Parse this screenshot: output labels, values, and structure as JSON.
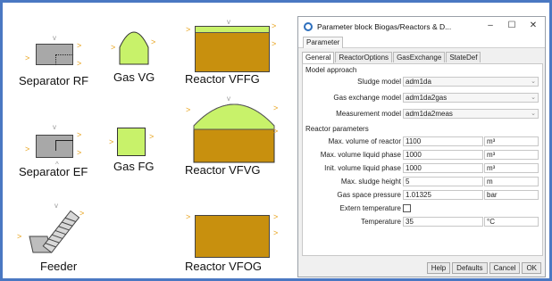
{
  "blocks": {
    "separator_rf": "Separator RF",
    "gas_vg": "Gas VG",
    "reactor_vffg": "Reactor VFFG",
    "separator_ef": "Separator EF",
    "gas_fg": "Gas FG",
    "reactor_vfvg": "Reactor VFVG",
    "feeder": "Feeder",
    "reactor_vfog": "Reactor VFOG"
  },
  "dialog": {
    "title": "Parameter block Biogas/Reactors & D...",
    "menu_label": "Parameter",
    "tabs": [
      "General",
      "ReactorOptions",
      "GasExchange",
      "StateDef"
    ],
    "section_model": "Model approach",
    "section_reactor": "Reactor parameters",
    "model_rows": [
      {
        "label": "Sludge model",
        "value": "adm1da"
      },
      {
        "label": "Gas exchange model",
        "value": "adm1da2gas"
      },
      {
        "label": "Measurement model",
        "value": "adm1da2meas"
      }
    ],
    "param_rows": [
      {
        "label": "Max. volume of reactor",
        "value": "1100",
        "unit": "m³"
      },
      {
        "label": "Max. volume liquid phase",
        "value": "1000",
        "unit": "m³"
      },
      {
        "label": "Init. volume liquid phase",
        "value": "1000",
        "unit": "m³"
      },
      {
        "label": "Max. sludge height",
        "value": "5",
        "unit": "m"
      },
      {
        "label": "Gas space pressure",
        "value": "1.01325",
        "unit": "bar"
      },
      {
        "label": "Extern temperature",
        "value": "",
        "unit": ""
      },
      {
        "label": "Temperature",
        "value": "35",
        "unit": "°C"
      }
    ],
    "buttons": {
      "help": "Help",
      "defaults": "Defaults",
      "cancel": "Cancel",
      "ok": "OK"
    }
  },
  "colors": {
    "sludge": "#c8900e",
    "gas": "#c8f26a",
    "frame": "#4a78c2"
  }
}
